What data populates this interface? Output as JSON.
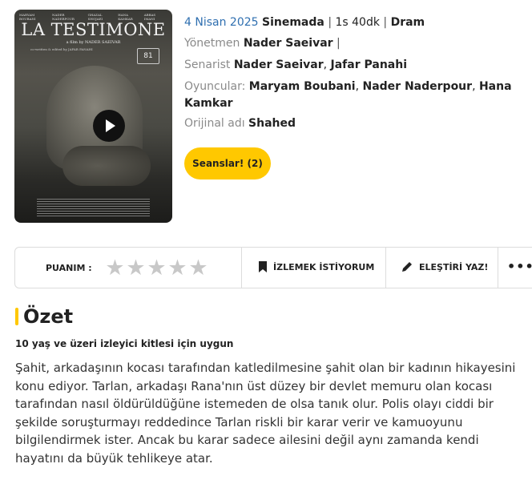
{
  "poster": {
    "cast_line": [
      "MARYAM BOUBANI",
      "NADER NADERPOUR",
      "GHAZAL SHOJAEI",
      "HANA KAMKAR",
      "ABBAS IMANI"
    ],
    "title": "LA TESTIMONE",
    "byline": "a film by NADER SAEIVAR",
    "written_line": "co-written & edited by JAFAR PANAHI",
    "festival_mark": "81"
  },
  "movie": {
    "release_date": "4 Nisan 2025",
    "status": "Sinemada",
    "separator": "|",
    "duration": "1s 40dk",
    "genre": "Dram",
    "director_label": "Yönetmen",
    "director": "Nader Saeivar",
    "writer_label": "Senarist",
    "writers": [
      "Nader Saeivar",
      "Jafar Panahi"
    ],
    "cast_label": "Oyuncular:",
    "cast": [
      "Maryam Boubani",
      "Nader Naderpour",
      "Hana Kamkar"
    ],
    "original_title_label": "Orijinal adı",
    "original_title": "Shahed",
    "sessions_button": "Seanslar! (2)"
  },
  "actionbar": {
    "rating_label": "PUANIM :",
    "rating_value": 0,
    "rating_max": 5,
    "watchlist_label": "İZLEMEK İSTİYORUM",
    "review_label": "ELEŞTİRİ YAZ!",
    "more_label": "•••",
    "icons": {
      "watchlist": "bookmark-icon",
      "review": "pencil-icon",
      "star": "star-icon"
    }
  },
  "summary": {
    "heading": "Özet",
    "age_rating": "10 yaş ve üzeri izleyici kitlesi için uygun",
    "text": "Şahit, arkadaşının kocası tarafından katledilmesine şahit olan bir kadının hikayesini konu ediyor. Tarlan, arkadaşı Rana'nın üst düzey bir devlet memuru olan kocası tarafından nasıl öldürüldüğüne istemeden de olsa tanık olur. Polis olayı ciddi bir şekilde soruşturmayı reddedince Tarlan riskli bir karar verir ve kamuoyunu bilgilendirmek ister. Ancak bu karar sadece ailesini değil aynı zamanda kendi hayatını da büyük tehlikeye atar."
  },
  "colors": {
    "accent": "#ffc800",
    "link": "#2f6fb0",
    "muted": "#8a8a8a",
    "star_empty": "#c8c8c8"
  }
}
